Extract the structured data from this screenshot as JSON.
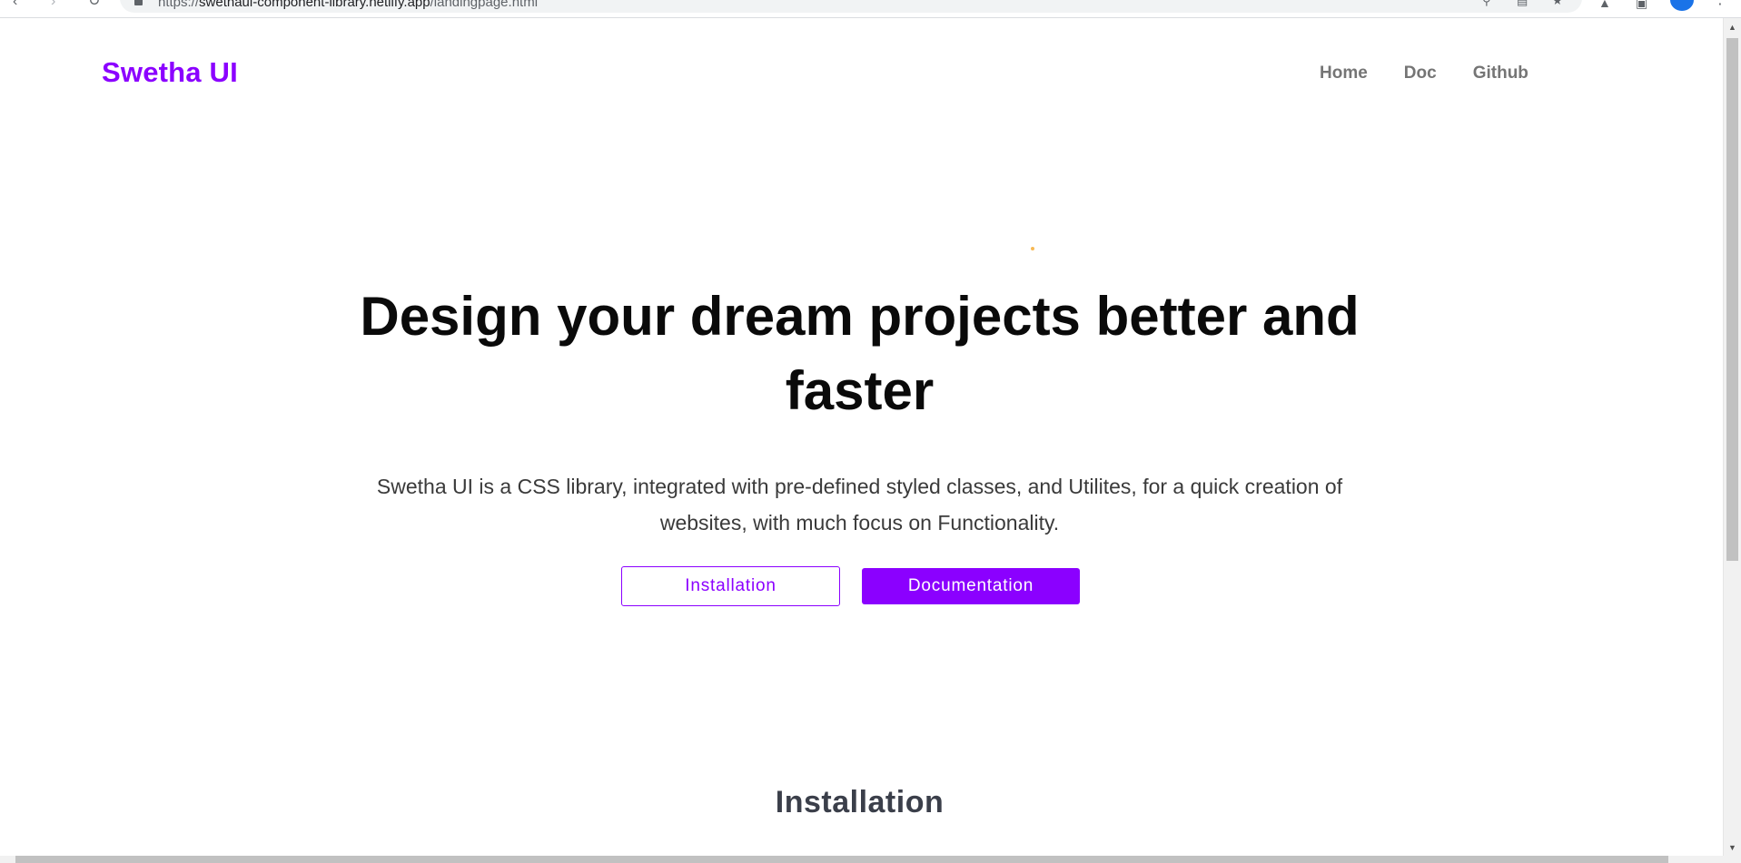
{
  "browser": {
    "url_scheme": "https://",
    "url_host": "swethaui-component-library.netlify.app",
    "url_path": "/landingpage.html",
    "icons": [
      "back-icon",
      "forward-icon",
      "reload-icon",
      "lock-icon",
      "search-icon",
      "share-icon",
      "star-icon",
      "extensions-icon",
      "window-icon",
      "profile-avatar",
      "menu-icon"
    ]
  },
  "nav": {
    "brand": "Swetha UI",
    "links": [
      "Home",
      "Doc",
      "Github"
    ]
  },
  "hero": {
    "title_line1": "Design your dream projects better and",
    "title_line2": "faster",
    "desc_line1": "Swetha UI is a CSS library, integrated with pre-defined styled classes, and Utilites, for a quick creation of",
    "desc_line2": "websites, with much focus on Functionality.",
    "primary_button": "Installation",
    "secondary_button": "Documentation"
  },
  "sections": {
    "installation_heading": "Installation"
  },
  "colors": {
    "accent": "#8b00ff",
    "nav_link": "#757575",
    "heading": "#0a0a0a",
    "body_text": "#3a3a3a",
    "section_heading": "#3b3f4a",
    "dot": "#f7b955"
  }
}
